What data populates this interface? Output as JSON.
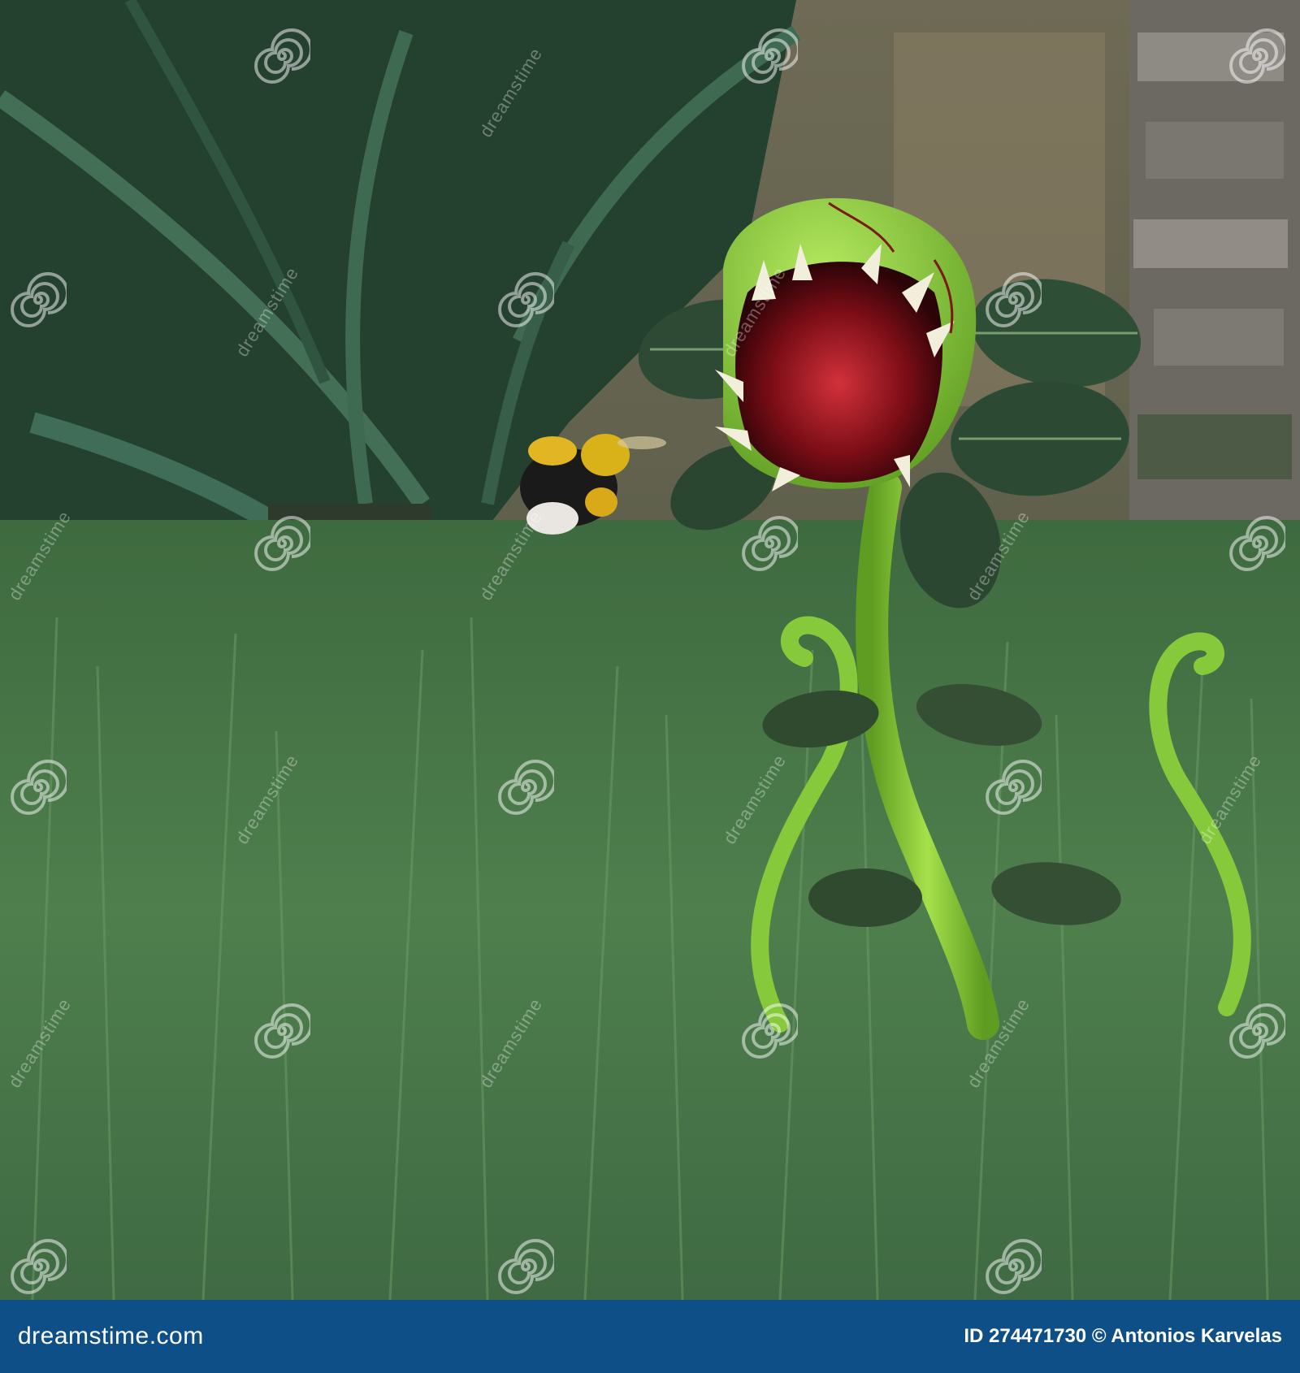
{
  "footer": {
    "brand": "dreamstime.com",
    "id_label": "ID 274471730",
    "copyright": "© Antonios Karvelas"
  },
  "watermark": {
    "text": "dreamstime",
    "icon": "spiral-watermark-icon"
  },
  "colors": {
    "footer_bg": "#0f4f88",
    "grass": "#3f6b43",
    "plant_green": "#8ccf3a",
    "mouth_red": "#a3121d"
  }
}
